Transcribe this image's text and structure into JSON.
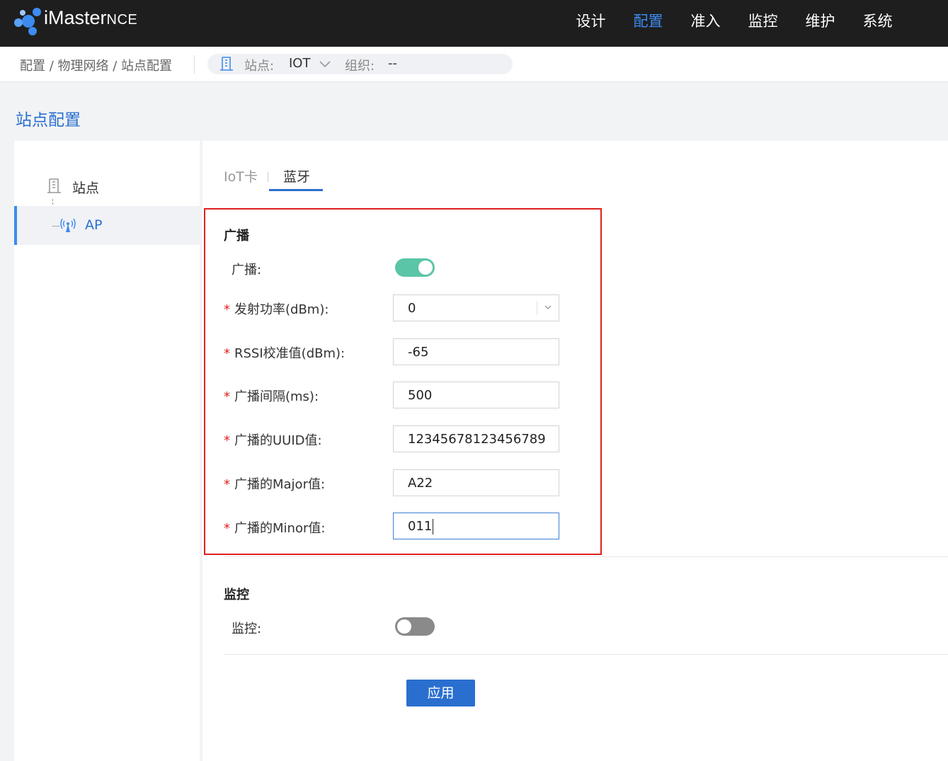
{
  "app": {
    "brand_main": "iMaster",
    "brand_sub": "NCE"
  },
  "nav": {
    "items": [
      {
        "label": "设计"
      },
      {
        "label": "配置",
        "active": true
      },
      {
        "label": "准入"
      },
      {
        "label": "监控"
      },
      {
        "label": "维护"
      },
      {
        "label": "系统"
      }
    ]
  },
  "breadcrumb": {
    "path": "配置 / 物理网络 / 站点配置"
  },
  "site_selector": {
    "site_label": "站点:",
    "site_value": "IOT",
    "org_label": "组织:",
    "org_value": "--"
  },
  "page": {
    "title": "站点配置"
  },
  "tree": {
    "root_label": "站点",
    "child_label": "AP"
  },
  "tabs": {
    "iot": "IoT卡",
    "bluetooth": "蓝牙"
  },
  "broadcast": {
    "section_title": "广播",
    "toggle_label": "广播:",
    "toggle_on": true,
    "fields": {
      "tx_power": {
        "label": "发射功率(dBm):",
        "value": "0"
      },
      "rssi": {
        "label": "RSSI校准值(dBm):",
        "value": "-65"
      },
      "interval": {
        "label": "广播间隔(ms):",
        "value": "500"
      },
      "uuid": {
        "label": "广播的UUID值:",
        "value": "12345678123456789"
      },
      "major": {
        "label": "广播的Major值:",
        "value": "A22"
      },
      "minor": {
        "label": "广播的Minor值:",
        "value": "011"
      }
    },
    "required_mark": "*"
  },
  "monitor": {
    "section_title": "监控",
    "toggle_label": "监控:",
    "toggle_on": false
  },
  "actions": {
    "apply_label": "应用"
  },
  "colors": {
    "accent": "#2a6fcf",
    "toggle_on": "#5bc5a7",
    "highlight_box": "#e02020"
  }
}
